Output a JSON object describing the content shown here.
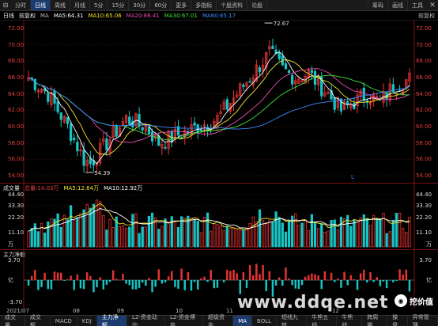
{
  "topbar": {
    "tabs": [
      {
        "label": "分时",
        "active": false
      },
      {
        "label": "日线",
        "active": true
      },
      {
        "label": "周线",
        "active": false
      },
      {
        "label": "月线",
        "active": false
      },
      {
        "label": "5分",
        "active": false
      },
      {
        "label": "15分",
        "active": false
      },
      {
        "label": "30分",
        "active": false
      },
      {
        "label": "60分",
        "active": false
      },
      {
        "label": "更多",
        "active": false
      },
      {
        "label": "多指标",
        "active": false
      },
      {
        "label": "个股资料",
        "active": false
      },
      {
        "label": "论股",
        "active": false
      }
    ],
    "right": [
      "筹码",
      "画线",
      "工具"
    ]
  },
  "mabar": {
    "daily": "日线",
    "adj": "前复权",
    "ma_label": "MA",
    "ma5": "MA5:64.31",
    "ma10": "MA10:65.06",
    "ma20": "MA20:66.41",
    "ma30": "MA30:67.01",
    "ma60": "MA60:65.17",
    "right": "前复权"
  },
  "colors": {
    "up": "#e83232",
    "down": "#17c5c5",
    "ma5": "#ffffff",
    "ma10": "#f5e42a",
    "ma20": "#e84cb4",
    "ma30": "#3ce23c",
    "ma60": "#3a8cff"
  },
  "price_panel": {
    "yticks": [
      "72.00",
      "70.00",
      "68.00",
      "66.00",
      "64.00",
      "62.00",
      "60.00",
      "58.00",
      "56.00",
      "54.00"
    ],
    "high_label": "72.67",
    "low_label": "54.39",
    "marker_label": "L"
  },
  "volume_panel": {
    "title": "成交量",
    "total": "总量:14.03万",
    "ma5": "MA5:12.64万",
    "ma10": "MA10:12.92万",
    "yticks": [
      "44.40",
      "33.30",
      "22.20",
      "11.10",
      "万"
    ]
  },
  "flow_panel": {
    "title": "主力净额",
    "yticks": [
      "3.70",
      "亿",
      "-3.70"
    ]
  },
  "xaxis": [
    "2021/07",
    "08",
    "09",
    "10",
    "11",
    "12"
  ],
  "bottombar": {
    "tabs": [
      {
        "label": "成交量",
        "active": false
      },
      {
        "label": "成交额",
        "active": false
      },
      {
        "label": "MACD",
        "active": false
      },
      {
        "label": "KDJ",
        "active": false
      },
      {
        "label": "主力净额",
        "active": true
      },
      {
        "label": "L2-资金动向",
        "active": false
      },
      {
        "label": "L2-资金博弈",
        "active": false
      },
      {
        "label": "超级资金",
        "active": false
      },
      {
        "label": "MA",
        "active": true
      },
      {
        "label": "BOLL",
        "active": false
      },
      {
        "label": "短线九转",
        "active": false
      },
      {
        "label": "牛熊五线",
        "active": false
      },
      {
        "label": "牛熊线",
        "active": false
      },
      {
        "label": "跨周期",
        "active": false
      },
      {
        "label": "操盘",
        "active": false
      },
      {
        "label": "异常管理",
        "active": false
      }
    ]
  },
  "watermark": {
    "brand": "挖价值",
    "url": "www.ddqe.net"
  }
}
